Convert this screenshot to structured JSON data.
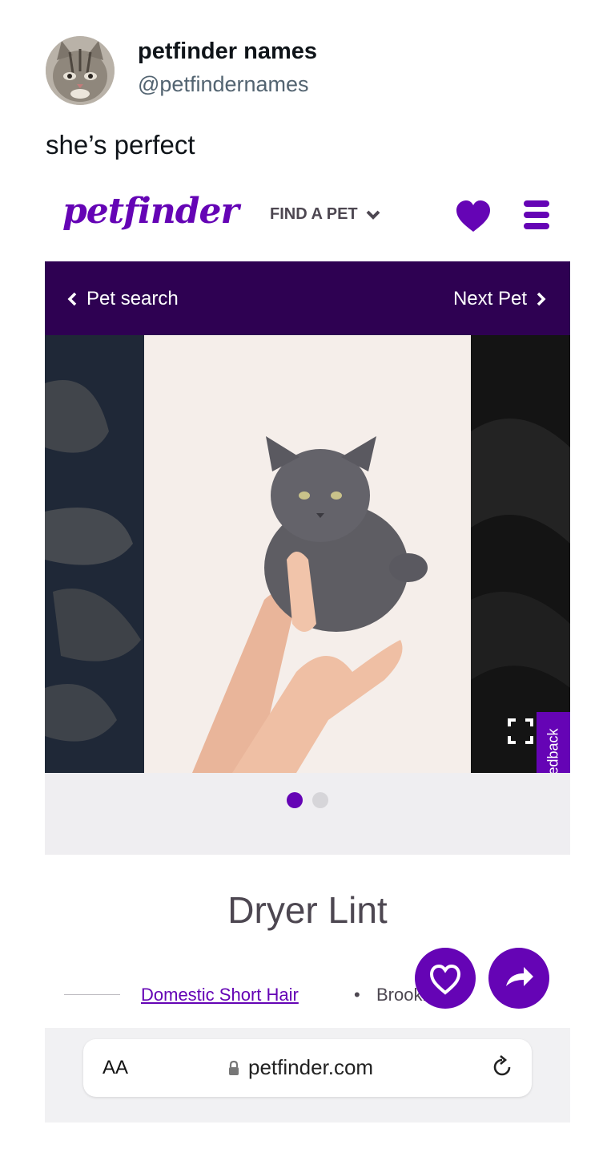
{
  "tweet": {
    "author_name": "petfinder names",
    "author_handle": "@petfindernames",
    "text": "she’s perfect"
  },
  "screenshot": {
    "logo": "petfinder",
    "nav": {
      "find_pet_label": "FIND A PET"
    },
    "topbar": {
      "back_label": "Pet search",
      "next_label": "Next Pet"
    },
    "gallery": {
      "feedback_label": "Feedback",
      "slide_count": 2,
      "active_slide": 1
    },
    "pet": {
      "name": "Dryer Lint",
      "breed": "Domestic Short Hair",
      "separator": "•",
      "location_partial": "Brookl"
    },
    "browser": {
      "text_size_label": "AA",
      "url": "petfinder.com"
    },
    "colors": {
      "brand_purple": "#6504b5",
      "topbar_purple": "#2e0152"
    }
  }
}
